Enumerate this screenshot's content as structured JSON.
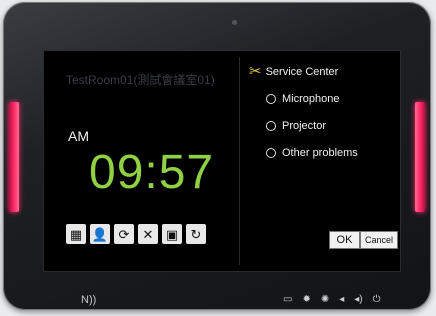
{
  "room_name": "TestRoom01(測試會議室01)",
  "period": "AM",
  "time": "09:57",
  "toolbar": [
    {
      "icon": "calendar-icon",
      "glyph": "▦"
    },
    {
      "icon": "user-icon",
      "glyph": "👤"
    },
    {
      "icon": "timer-icon",
      "glyph": "⟳"
    },
    {
      "icon": "tools-icon",
      "glyph": "✕"
    },
    {
      "icon": "calendar-cancel-icon",
      "glyph": "▣"
    },
    {
      "icon": "refresh-icon",
      "glyph": "↻"
    }
  ],
  "service": {
    "title": "Service Center",
    "options": [
      "Microphone",
      "Projector",
      "Other problems"
    ]
  },
  "buttons": {
    "ok": "OK",
    "cancel": "Cancel"
  },
  "bottom": {
    "nfc": "N))"
  },
  "colors": {
    "clock": "#8fd142",
    "led": "#ff2a6a",
    "service_icon": "#e2c230"
  }
}
